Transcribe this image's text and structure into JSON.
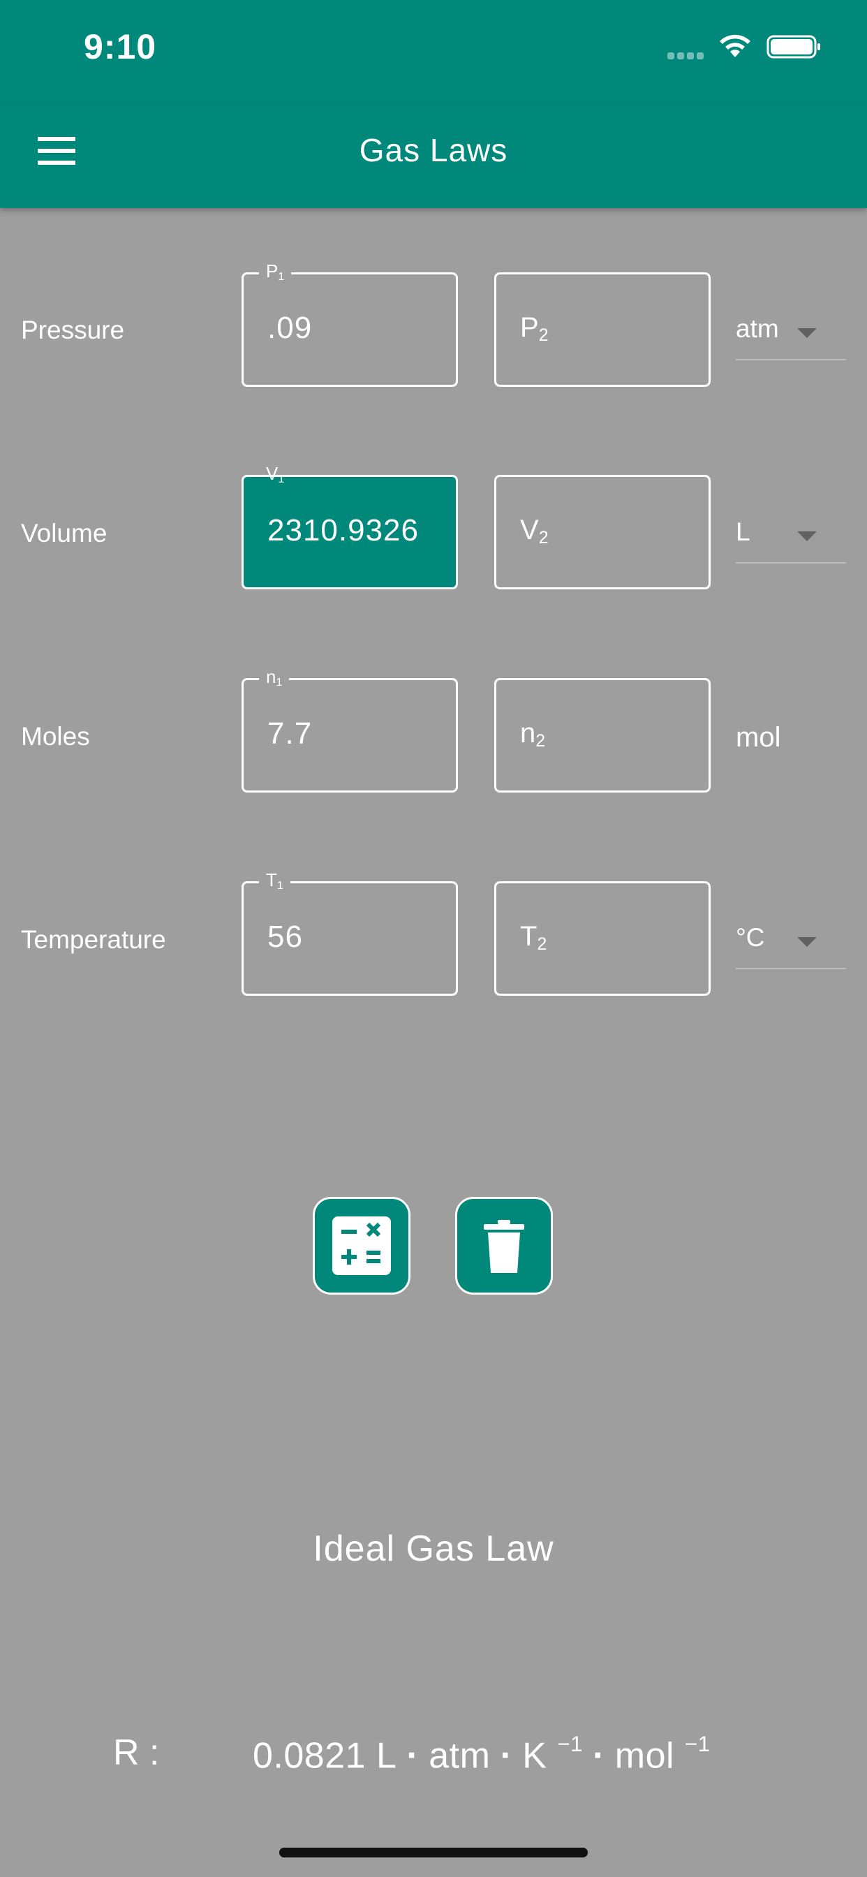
{
  "status_bar": {
    "time": "9:10"
  },
  "app_bar": {
    "title": "Gas Laws",
    "menu_icon": "hamburger-menu-icon"
  },
  "rows": [
    {
      "label": "Pressure",
      "field1": {
        "legend_main": "P",
        "legend_sub": "1",
        "value": ".09"
      },
      "field2": {
        "placeholder_main": "P",
        "placeholder_sub": "2",
        "value": ""
      },
      "unit": "atm",
      "unit_has_dropdown": true
    },
    {
      "label": "Volume",
      "field1": {
        "legend_main": "V",
        "legend_sub": "1",
        "value": "2310.9326",
        "highlighted": true
      },
      "field2": {
        "placeholder_main": "V",
        "placeholder_sub": "2",
        "value": ""
      },
      "unit": "L",
      "unit_has_dropdown": true
    },
    {
      "label": "Moles",
      "field1": {
        "legend_main": "n",
        "legend_sub": "1",
        "value": "7.7"
      },
      "field2": {
        "placeholder_main": "n",
        "placeholder_sub": "2",
        "value": ""
      },
      "unit": "mol",
      "unit_has_dropdown": false
    },
    {
      "label": "Temperature",
      "field1": {
        "legend_main": "T",
        "legend_sub": "1",
        "value": "56"
      },
      "field2": {
        "placeholder_main": "T",
        "placeholder_sub": "2",
        "value": ""
      },
      "unit": "°C",
      "unit_has_dropdown": true
    }
  ],
  "actions": {
    "calculate_icon": "calculator-icon",
    "clear_icon": "trash-icon"
  },
  "law_title": "Ideal Gas Law",
  "gas_constant": {
    "label": "R :",
    "value": "0.0821",
    "unit_1": "L",
    "unit_2": "atm",
    "unit_3": "K",
    "unit_3_exp": "−1",
    "unit_4": "mol",
    "unit_4_exp": "−1",
    "separator": "·"
  },
  "colors": {
    "primary": "#00897b",
    "background": "#9e9e9e",
    "on_primary": "#ffffff"
  }
}
